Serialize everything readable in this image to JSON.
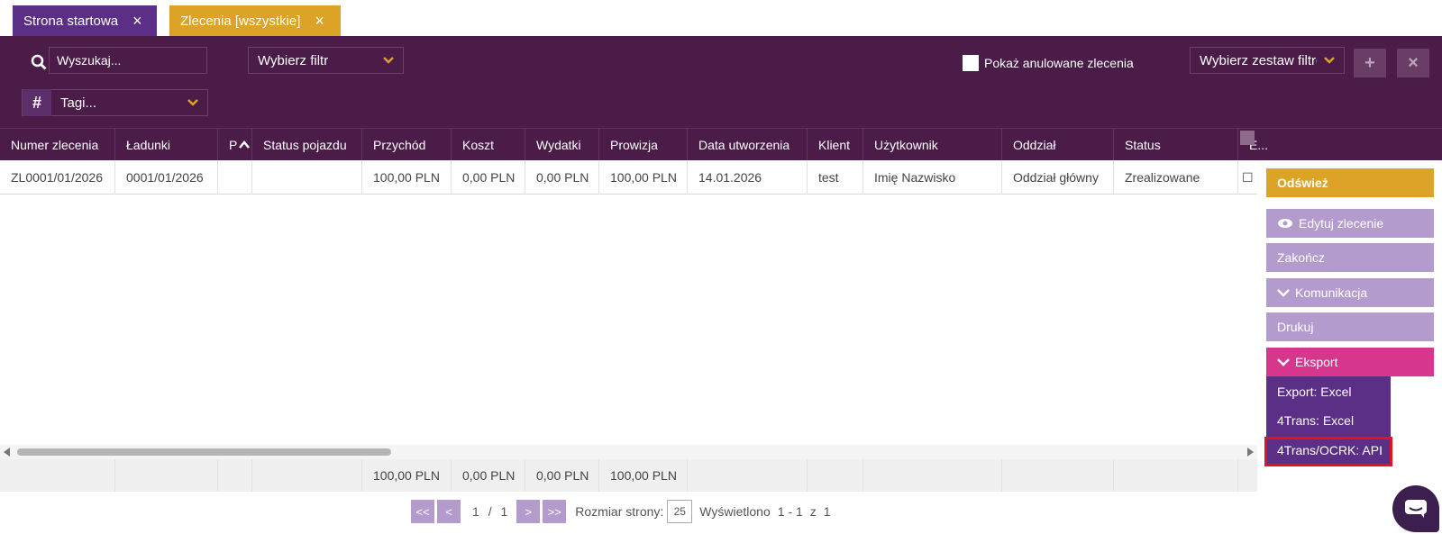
{
  "tabs": [
    {
      "label": "Strona startowa"
    },
    {
      "label": "Zlecenia [wszystkie]"
    }
  ],
  "toolbar": {
    "search_placeholder": "Wyszukaj...",
    "filter_select": "Wybierz filtr",
    "tags_select": "Tagi...",
    "show_cancelled_label": "Pokaż anulowane zlecenia",
    "filter_set_select": "Wybierz zestaw filtrów",
    "plus_label": "+",
    "close_label": "×"
  },
  "columns": [
    "Numer zlecenia",
    "Ładunki",
    "P",
    "Status pojazdu",
    "Przychód",
    "Koszt",
    "Wydatki",
    "Prowizja",
    "Data utworzenia",
    "Klient",
    "Użytkownik",
    "Oddział",
    "Status",
    "E..."
  ],
  "rows": [
    {
      "numer": "ZL0001/01/2026",
      "ladunki": "0001/01/2026",
      "p": "",
      "status_pojazdu": "",
      "przychod": "100,00 PLN",
      "koszt": "0,00 PLN",
      "wydatki": "0,00 PLN",
      "prowizja": "100,00 PLN",
      "data": "14.01.2026",
      "klient": "test",
      "uzytkownik": "Imię Nazwisko",
      "oddzial": "Oddział główny",
      "status": "Zrealizowane",
      "e": "☐ I"
    }
  ],
  "totals": {
    "przychod": "100,00 PLN",
    "koszt": "0,00 PLN",
    "wydatki": "0,00 PLN",
    "prowizja": "100,00 PLN"
  },
  "pager": {
    "first": "<<",
    "prev": "<",
    "current": "1",
    "sep": "/",
    "total": "1",
    "next": ">",
    "last": ">>",
    "size_label": "Rozmiar strony:",
    "size": "25",
    "shown_label": "Wyświetlono",
    "shown_range": "1 - 1",
    "of_label": "z",
    "shown_total": "1"
  },
  "side_buttons": {
    "refresh": "Odśwież",
    "edit": "Edytuj zlecenie",
    "finish": "Zakończ",
    "communication": "Komunikacja",
    "print": "Drukuj",
    "export": "Eksport"
  },
  "export_menu": [
    "Export: Excel",
    "4Trans: Excel",
    "4Trans/OCRK: API"
  ],
  "colors": {
    "header_bg": "#4b1c48",
    "tab_active": "#5c2f86",
    "tab_orders": "#dca326",
    "refresh": "#dca326",
    "light_button": "#b39bcd",
    "export": "#d6368e",
    "highlight": "#e0141e"
  }
}
